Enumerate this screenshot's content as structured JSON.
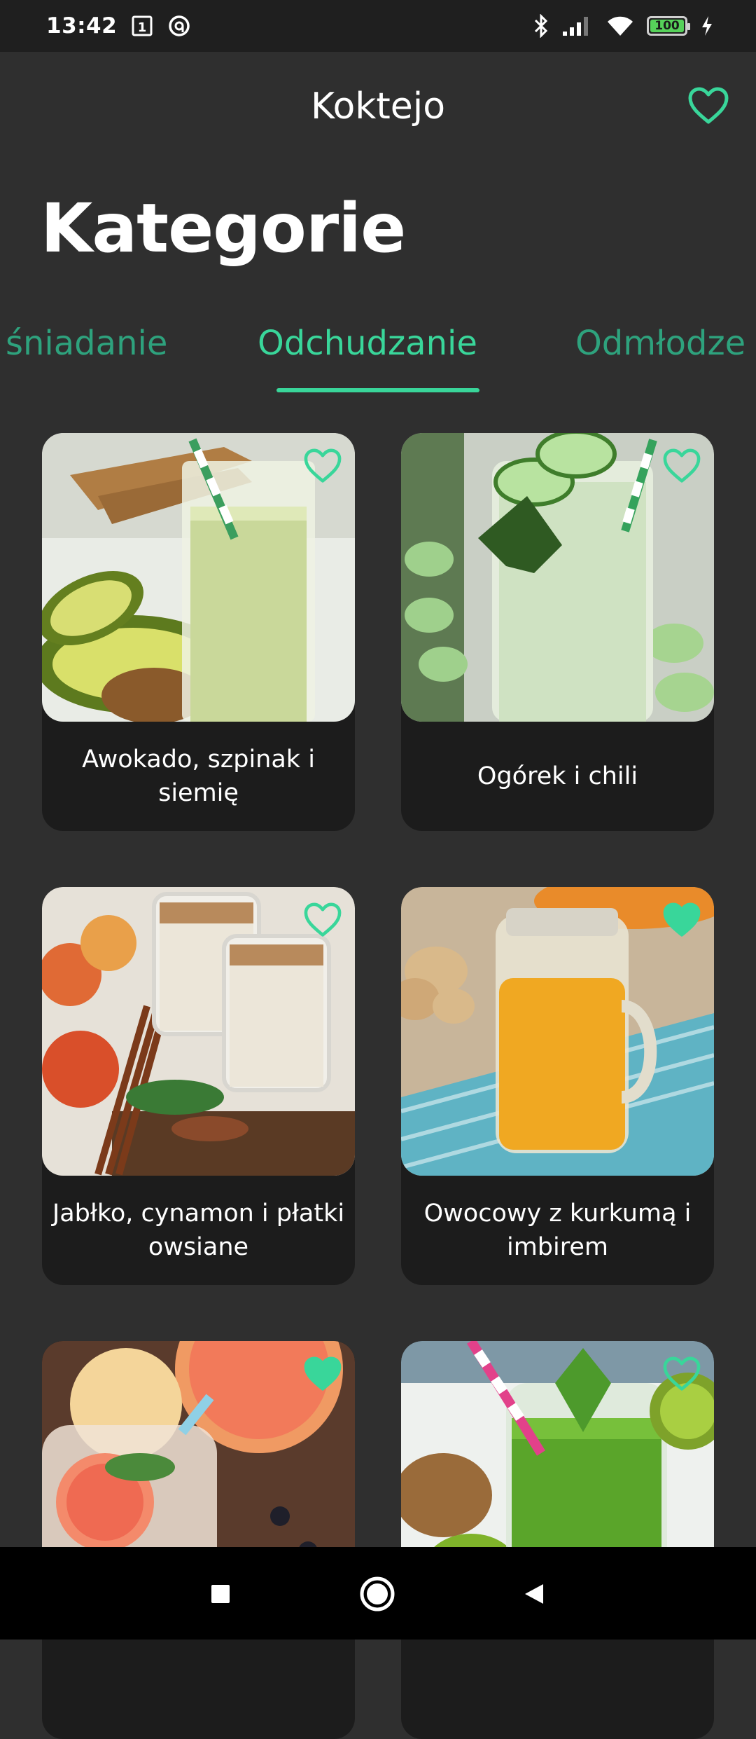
{
  "status_bar": {
    "time": "13:42",
    "battery": "100",
    "icons": [
      "sim-card-icon",
      "data-saver-icon",
      "bluetooth-icon",
      "signal-icon",
      "wifi-icon",
      "battery-icon",
      "charging-icon"
    ]
  },
  "app_bar": {
    "title": "Koktejo",
    "favorites_icon": "heart-outline-icon"
  },
  "section": {
    "title": "Kategorie"
  },
  "tabs": [
    {
      "label": "śniadanie"
    },
    {
      "label": "Odchudzanie",
      "active": true
    },
    {
      "label": "Odmłodze"
    }
  ],
  "cards": [
    {
      "title": "Awokado, szpinak i siemię",
      "favorite": false,
      "image": "avocado smoothie"
    },
    {
      "title": "Ogórek i chili",
      "favorite": false,
      "image": "cucumber smoothie"
    },
    {
      "title": "Jabłko, cynamon i płatki owsiane",
      "favorite": false,
      "image": "apple cinnamon smoothie"
    },
    {
      "title": "Owocowy z kurkumą i imbirem",
      "favorite": true,
      "image": "turmeric ginger smoothie"
    },
    {
      "title": "",
      "favorite": true,
      "image": "grapefruit drink"
    },
    {
      "title": "",
      "favorite": false,
      "image": "kiwi green smoothie"
    }
  ],
  "colors": {
    "accent": "#39d69a",
    "background": "#2f2f2f",
    "card": "#1c1c1c"
  }
}
